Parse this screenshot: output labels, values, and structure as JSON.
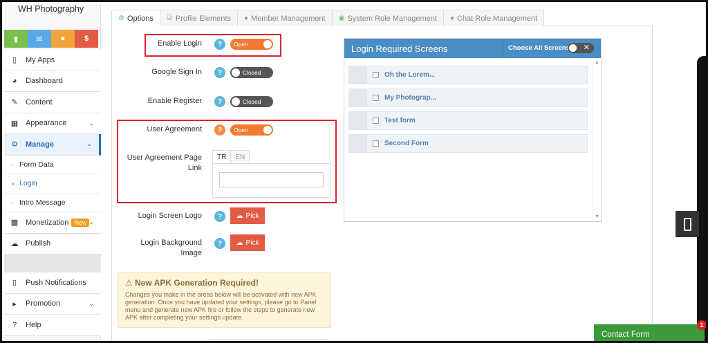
{
  "app": {
    "title": "WH Photography"
  },
  "quick_icons": [
    "chart-icon",
    "mail-icon",
    "users-icon",
    "dollar-icon"
  ],
  "sidebar": {
    "items": [
      {
        "label": "My Apps",
        "icon": "phone-icon"
      },
      {
        "label": "Dashboard",
        "icon": "dashboard-icon"
      },
      {
        "label": "Content",
        "icon": "edit-icon"
      },
      {
        "label": "Appearance",
        "icon": "grid-icon"
      },
      {
        "label": "Manage",
        "icon": "gears-icon"
      },
      {
        "label": "Monetization",
        "icon": "money-icon",
        "badge": "New"
      },
      {
        "label": "Publish",
        "icon": "upload-icon"
      },
      {
        "label": "Push Notifications",
        "icon": "phone-icon"
      },
      {
        "label": "Promotion",
        "icon": "megaphone-icon"
      },
      {
        "label": "Help",
        "icon": "question-icon"
      }
    ],
    "manage_sub": [
      "Form Data",
      "Login",
      "Intro Message"
    ],
    "active": "Manage",
    "active_sub": "Login"
  },
  "tabs": [
    {
      "label": "Options",
      "icon": "gear-icon"
    },
    {
      "label": "Profile Elements",
      "icon": "check-square-icon"
    },
    {
      "label": "Member Management",
      "icon": "users-icon"
    },
    {
      "label": "System Role Management",
      "icon": "eye-icon"
    },
    {
      "label": "Chat Role Management",
      "icon": "chat-icon"
    }
  ],
  "form": {
    "enable_login": {
      "label": "Enable Login",
      "state": "Open"
    },
    "google_sign_in": {
      "label": "Google Sign In",
      "state": "Closed"
    },
    "enable_register": {
      "label": "Enable Register",
      "state": "Closed"
    },
    "user_agreement": {
      "label": "User Agreement",
      "state": "Open"
    },
    "user_agreement_link": {
      "label": "User Agreement Page Link",
      "lang_tabs": [
        "TR",
        "EN"
      ],
      "value": ""
    },
    "login_screen_logo": {
      "label": "Login Screen Logo",
      "button": "Pick"
    },
    "login_background": {
      "label": "Login Background Image",
      "button": "Pick"
    }
  },
  "warning": {
    "title": "New APK Generation Required!",
    "text": "Changes you make in the areas below will be activated with new APK generation. Once you have updated your settings, please go to Panel menu and generate new APK fire or follow the steps to generate new APK after completing your settings update."
  },
  "login_required": {
    "title": "Login Required Screens",
    "choose_all": "Choose All Screens",
    "screens": [
      "Oh the Lorem...",
      "My Photograp...",
      "Test form",
      "Second Form"
    ]
  },
  "contact": {
    "label": "Contact Form",
    "badge": "1"
  },
  "colors": {
    "accent": "#f07b2e",
    "primary": "#4a8ec6",
    "danger": "#e25b45",
    "success": "#3c9a3a"
  }
}
